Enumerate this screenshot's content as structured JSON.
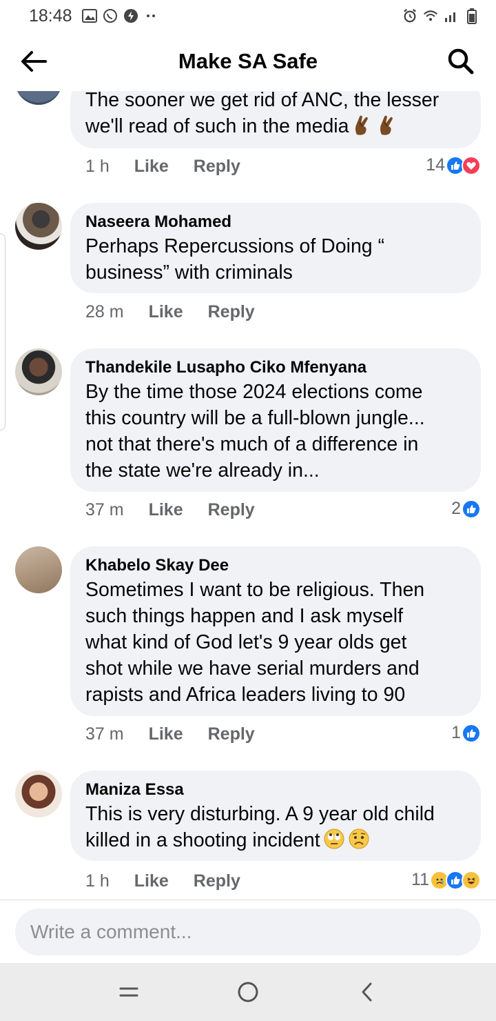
{
  "status_bar": {
    "time": "18:48"
  },
  "header": {
    "title": "Make SA Safe"
  },
  "comments": [
    {
      "author": "",
      "text": "The sooner we get rid of ANC, the lesser\nwe'll read of such in the media",
      "time": "1 h",
      "like_label": "Like",
      "reply_label": "Reply",
      "reaction_count": "14",
      "reactions": [
        "like",
        "love"
      ],
      "inline_emojis": [
        "crossed-fingers",
        "crossed-fingers"
      ]
    },
    {
      "author": "Naseera Mohamed",
      "text": "Perhaps Repercussions of Doing “\nbusiness” with criminals",
      "time": "28 m",
      "like_label": "Like",
      "reply_label": "Reply",
      "reaction_count": "",
      "reactions": []
    },
    {
      "author": "Thandekile Lusapho Ciko Mfenyana",
      "text": "By the time those 2024 elections come\nthis country will be a full-blown jungle...\nnot that there's much of a difference in\nthe state we're already in...",
      "time": "37 m",
      "like_label": "Like",
      "reply_label": "Reply",
      "reaction_count": "2",
      "reactions": [
        "like"
      ]
    },
    {
      "author": "Khabelo Skay Dee",
      "text": "Sometimes I want to be religious. Then\nsuch things happen and I ask myself\nwhat kind of God let's 9 year olds get\nshot while we have serial murders and\nrapists and Africa  leaders living to 90",
      "time": "37 m",
      "like_label": "Like",
      "reply_label": "Reply",
      "reaction_count": "1",
      "reactions": [
        "like"
      ]
    },
    {
      "author": "Maniza Essa",
      "text": "This is very disturbing. A 9 year old child\nkilled in a shooting incident",
      "time": "1 h",
      "like_label": "Like",
      "reply_label": "Reply",
      "reaction_count": "11",
      "reactions": [
        "sad",
        "like",
        "haha"
      ],
      "inline_emojis": [
        "eye-roll-face",
        "sad-face"
      ]
    }
  ],
  "composer": {
    "placeholder": "Write a comment..."
  },
  "colors": {
    "like": "#1877f2",
    "love": "#f33e58",
    "bubble": "#f0f2f5",
    "meta": "#65676b"
  }
}
